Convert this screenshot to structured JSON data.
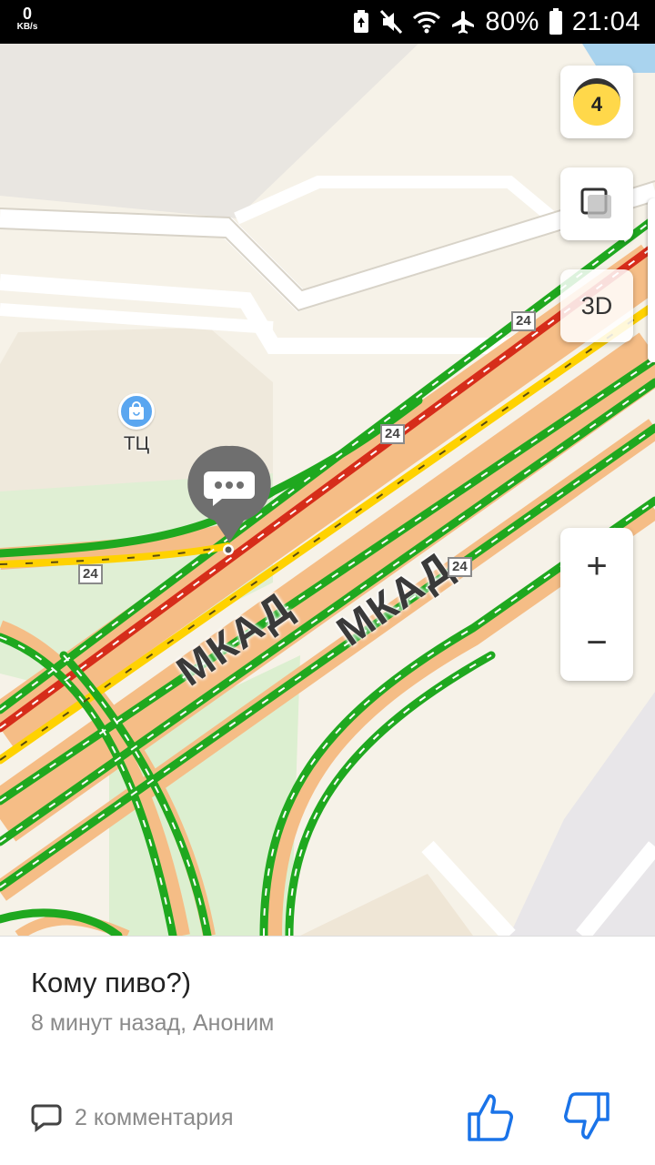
{
  "status_bar": {
    "net_speed_value": "0",
    "net_speed_unit": "KB/s",
    "battery": "80%",
    "time": "21:04",
    "icons": [
      "battery-saver-icon",
      "mute-icon",
      "wifi-icon",
      "airplane-icon",
      "battery-icon"
    ]
  },
  "map": {
    "traffic_level": "4",
    "mode_3d_label": "3D",
    "zoom_in_label": "+",
    "zoom_out_label": "−",
    "poi_label": "ТЦ",
    "road_name_1": "МКАД",
    "road_name_2": "МКАД",
    "road_number": "24",
    "colors": {
      "green": "#1fa81f",
      "red": "#d62d1a",
      "yellow": "#ffd200",
      "orange_road": "#f6c089",
      "park": "#dff0d2",
      "building": "#e8e4dc"
    }
  },
  "event": {
    "title": "Кому пиво?)",
    "meta": "8 минут назад, Аноним",
    "comments_label": "2 комментария",
    "accent_color": "#1a73e8"
  }
}
